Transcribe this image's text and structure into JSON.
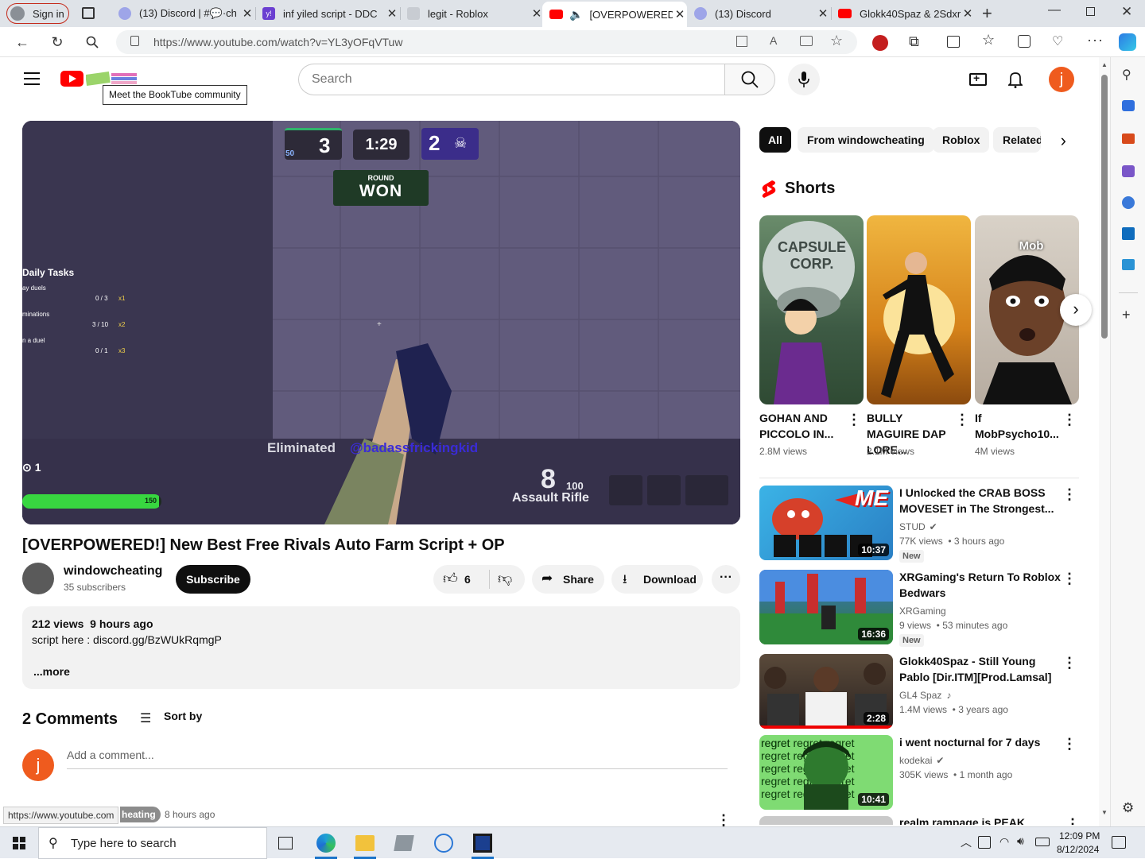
{
  "browser": {
    "sign_in": "Sign in",
    "tabs": [
      {
        "title": "(13) Discord | #💬·ch",
        "badge": "13"
      },
      {
        "title": "inf yiled script - DDC",
        "badge": "y!"
      },
      {
        "title": "legit - Roblox",
        "badge": ""
      },
      {
        "title": "[OVERPOWERED!",
        "badge": ""
      },
      {
        "title": "(13) Discord",
        "badge": "13"
      },
      {
        "title": "Glokk40Spaz & 2Sdxr",
        "badge": ""
      }
    ],
    "url": "https://www.youtube.com/watch?v=YL3yOFqVTuw"
  },
  "header": {
    "search_placeholder": "Search",
    "avatar_letter": "j",
    "tooltip": "Meet the BookTube community"
  },
  "video": {
    "title": "[OVERPOWERED!] New Best Free Rivals Auto Farm Script + OP",
    "channel": "windowcheating",
    "subscribers": "35 subscribers",
    "subscribe_label": "Subscribe",
    "likes": "6",
    "share_label": "Share",
    "download_label": "Download",
    "hud": {
      "score_left": "3",
      "timer": "1:29",
      "score_right": "2",
      "level": "50",
      "round_label": "ROUND",
      "round_result": "WON",
      "daily_tasks": "Daily Tasks",
      "tasks": [
        {
          "name": "ay duels",
          "progress": "0 / 3",
          "mult": "x1"
        },
        {
          "name": "minations",
          "progress": "3 / 10",
          "mult": "x2"
        },
        {
          "name": "n a duel",
          "progress": "0 / 1",
          "mult": "x3"
        }
      ],
      "eliminated": "Eliminated",
      "eliminated_player": "@badassfrickingkid",
      "ammo": "8",
      "reserve": "100",
      "weapon": "Assault Rifle",
      "health": "150",
      "health_fraction": 0.98,
      "lives": "1"
    }
  },
  "description": {
    "views_time": "212 views  9 hours ago",
    "text": "script here : discord.gg/BzWUkRqmgP",
    "more": "...more"
  },
  "comments": {
    "count_label": "2 Comments",
    "sort_label": "Sort by",
    "add_placeholder": "Add a comment...",
    "first_author_fragment": "heating",
    "first_time": "8 hours ago"
  },
  "status_url": "https://www.youtube.com",
  "chips": [
    "All",
    "From windowcheating",
    "Roblox",
    "Related"
  ],
  "shorts": {
    "heading": "Shorts",
    "items": [
      {
        "title": "GOHAN AND PICCOLO IN...",
        "views": "2.8M views",
        "art_text": "CAPSULE CORP."
      },
      {
        "title": "BULLY MAGUIRE DAP LORE...",
        "views": "2.1M views",
        "art_text": ""
      },
      {
        "title": "If MobPsycho10...",
        "views": "4M views",
        "art_text": "Mob"
      }
    ]
  },
  "recommendations": [
    {
      "title": "I Unlocked the CRAB BOSS MOVESET in The Strongest...",
      "channel": "STUD",
      "verified": true,
      "music": false,
      "meta": "77K views  • 3 hours ago",
      "badge": "New",
      "duration": "10:37",
      "thumb_text": "ME"
    },
    {
      "title": "XRGaming's Return To Roblox Bedwars",
      "channel": "XRGaming",
      "verified": false,
      "music": false,
      "meta": "9 views  • 53 minutes ago",
      "badge": "New",
      "duration": "16:36",
      "thumb_text": ""
    },
    {
      "title": "Glokk40Spaz - Still Young Pablo [Dir.ITM][Prod.Lamsal]",
      "channel": "GL4 Spaz",
      "verified": false,
      "music": true,
      "meta": "1.4M views  • 3 years ago",
      "badge": "",
      "duration": "2:28",
      "thumb_text": ""
    },
    {
      "title": "i went nocturnal for 7 days",
      "channel": "kodekai",
      "verified": true,
      "music": false,
      "meta": "305K views  • 1 month ago",
      "badge": "",
      "duration": "10:41",
      "thumb_text": "regret"
    },
    {
      "title": "realm rampage is PEAK",
      "channel": "",
      "verified": false,
      "music": false,
      "meta": "",
      "badge": "",
      "duration": "",
      "thumb_text": ""
    }
  ],
  "taskbar": {
    "search_placeholder": "Type here to search",
    "time": "12:09 PM",
    "date": "8/12/2024"
  }
}
